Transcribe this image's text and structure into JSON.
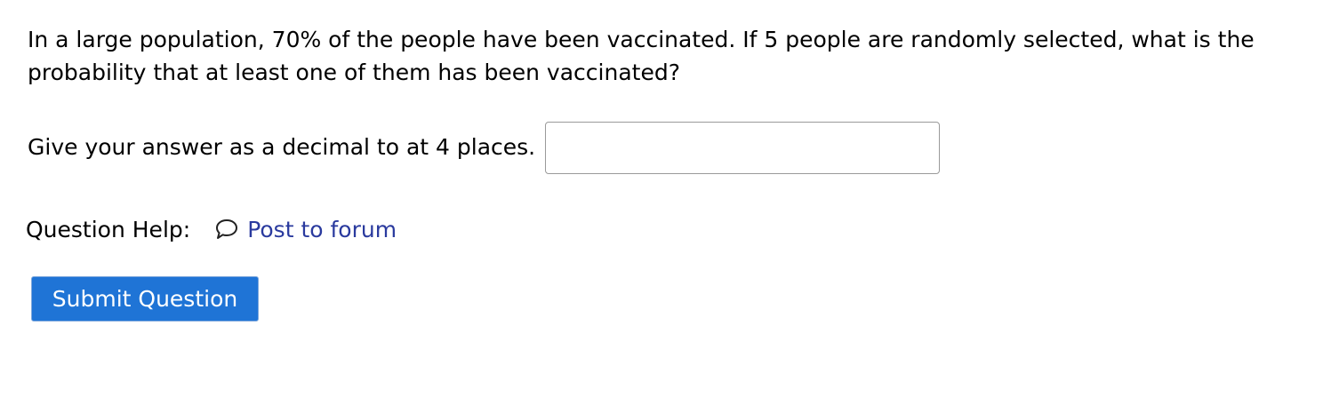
{
  "question": {
    "text": "In a large population, 70% of the people have been vaccinated. If 5 people are randomly selected, what is the probability that at least one of them has been vaccinated?"
  },
  "answer": {
    "label": "Give your answer as a decimal to at 4 places.",
    "value": "",
    "placeholder": ""
  },
  "help": {
    "label": "Question Help:",
    "forum_icon": "speech-bubble-icon",
    "forum_link": "Post to forum"
  },
  "actions": {
    "submit_label": "Submit Question"
  },
  "colors": {
    "link": "#2a3a9e",
    "button_bg": "#1f74d6",
    "button_text": "#ffffff",
    "input_border": "#9a9a9a"
  }
}
